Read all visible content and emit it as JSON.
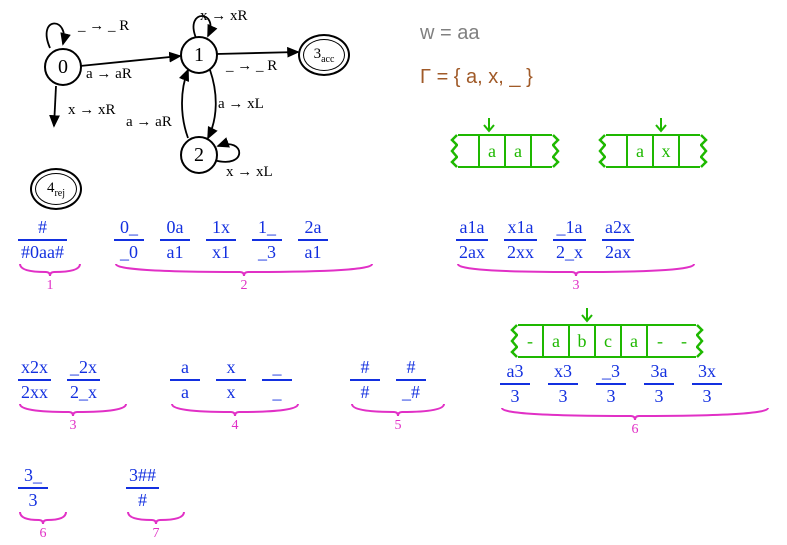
{
  "machine": {
    "states": {
      "s0": "0",
      "s1": "1",
      "s2": "2",
      "s3": "3",
      "s4": "4",
      "acc_sub": "acc",
      "rej_sub": "rej"
    },
    "transitions": {
      "s0_self": "_ → _ R",
      "s0_s1": "a → aR",
      "s0_s4": "x → xR",
      "s1_self": "x → xR",
      "s1_s3": "_ → _ R",
      "s1_s2": "a → xL",
      "s2_s1": "a → aR",
      "s2_self": "x → xL"
    }
  },
  "input": {
    "label": "w = aa"
  },
  "alphabet": {
    "label": "Γ  = { a, x, _ }"
  },
  "tapes": {
    "t1": [
      "",
      "a",
      "a",
      ""
    ],
    "t2": [
      "",
      "a",
      "x",
      ""
    ],
    "t3": [
      "-",
      "a",
      "b",
      "c",
      "a",
      "-",
      "-"
    ]
  },
  "tiles": {
    "g1": [
      {
        "top": "#",
        "bot": "#0aa#"
      }
    ],
    "g2": [
      {
        "top": "0_",
        "bot": "_0"
      },
      {
        "top": "0a",
        "bot": "a1"
      },
      {
        "top": "1x",
        "bot": "x1"
      },
      {
        "top": "1_",
        "bot": "_3"
      },
      {
        "top": "2a",
        "bot": "a1"
      }
    ],
    "g3a": [
      {
        "top": "a1a",
        "bot": "2ax"
      },
      {
        "top": "x1a",
        "bot": "2xx"
      },
      {
        "top": "_1a",
        "bot": "2_x"
      },
      {
        "top": "a2x",
        "bot": "2ax"
      }
    ],
    "g3b": [
      {
        "top": "x2x",
        "bot": "2xx"
      },
      {
        "top": "_2x",
        "bot": "2_x"
      }
    ],
    "g4": [
      {
        "top": "a",
        "bot": "a"
      },
      {
        "top": "x",
        "bot": "x"
      },
      {
        "top": "_",
        "bot": "_"
      }
    ],
    "g5": [
      {
        "top": "#",
        "bot": "#"
      },
      {
        "top": "#",
        "bot": "_#"
      }
    ],
    "g6a": [
      {
        "top": "a3",
        "bot": "3"
      },
      {
        "top": "x3",
        "bot": "3"
      },
      {
        "top": "_3",
        "bot": "3"
      },
      {
        "top": "3a",
        "bot": "3"
      },
      {
        "top": "3x",
        "bot": "3"
      }
    ],
    "g6b": [
      {
        "top": "3_",
        "bot": "3"
      }
    ],
    "g7": [
      {
        "top": "3##",
        "bot": "#"
      }
    ]
  },
  "group_labels": {
    "g1": "1",
    "g2": "2",
    "g3": "3",
    "g4": "4",
    "g5": "5",
    "g6": "6",
    "g7": "7"
  }
}
